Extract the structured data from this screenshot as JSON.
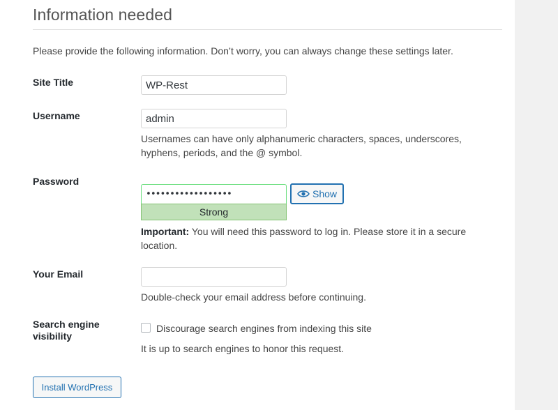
{
  "page": {
    "heading": "Information needed",
    "intro": "Please provide the following information. Don’t worry, you can always change these settings later."
  },
  "fields": {
    "site_title": {
      "label": "Site Title",
      "value": "WP-Rest"
    },
    "username": {
      "label": "Username",
      "value": "admin",
      "description_line1": "Usernames can have only alphanumeric characters, spaces, underscores,",
      "description_line2": "hyphens, periods, and the @ symbol."
    },
    "password": {
      "label": "Password",
      "masked_value": "••••••••••••••••••",
      "strength": "Strong",
      "show_label": "Show",
      "important_label": "Important:",
      "important_text_line1": " You will need this password to log in. Please store it in a secure",
      "important_text_line2": "location."
    },
    "email": {
      "label": "Your Email",
      "value": "",
      "description": "Double-check your email address before continuing."
    },
    "search_visibility": {
      "label_line1": "Search engine",
      "label_line2": "visibility",
      "checkbox_label": "Discourage search engines from indexing this site",
      "checked": false,
      "description": "It is up to search engines to honor this request."
    }
  },
  "actions": {
    "install_label": "Install WordPress"
  },
  "colors": {
    "accent": "#2271b1",
    "strength_bg": "#c1e1b9",
    "strength_border": "#83c373"
  }
}
